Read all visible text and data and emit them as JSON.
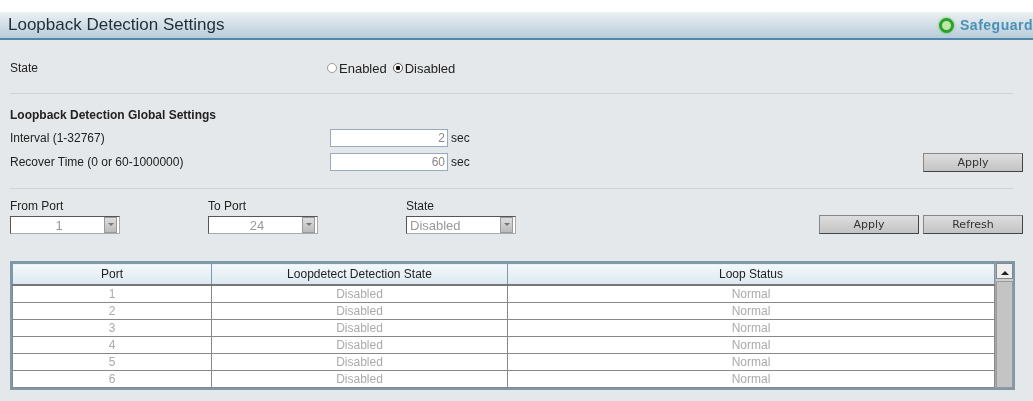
{
  "header": {
    "title": "Loopback Detection Settings",
    "badge": "Safeguard"
  },
  "state": {
    "label": "State",
    "options": [
      {
        "label": "Enabled",
        "selected": false
      },
      {
        "label": "Disabled",
        "selected": true
      }
    ]
  },
  "global_settings": {
    "heading": "Loopback Detection Global Settings",
    "fields": [
      {
        "label": "Interval (1-32767)",
        "value": "2",
        "unit": "sec"
      },
      {
        "label": "Recover Time (0 or 60-1000000)",
        "value": "60",
        "unit": "sec"
      }
    ],
    "apply_button": "Apply"
  },
  "port_settings": {
    "selects": [
      {
        "label": "From Port",
        "value": "1"
      },
      {
        "label": "To Port",
        "value": "24"
      },
      {
        "label": "State",
        "value": "Disabled"
      }
    ],
    "buttons": [
      "Apply",
      "Refresh"
    ]
  },
  "table": {
    "columns": [
      "Port",
      "Loopdetect Detection State",
      "Loop Status"
    ],
    "rows": [
      [
        "1",
        "Disabled",
        "Normal"
      ],
      [
        "2",
        "Disabled",
        "Normal"
      ],
      [
        "3",
        "Disabled",
        "Normal"
      ],
      [
        "4",
        "Disabled",
        "Normal"
      ],
      [
        "5",
        "Disabled",
        "Normal"
      ],
      [
        "6",
        "Disabled",
        "Normal"
      ]
    ]
  }
}
